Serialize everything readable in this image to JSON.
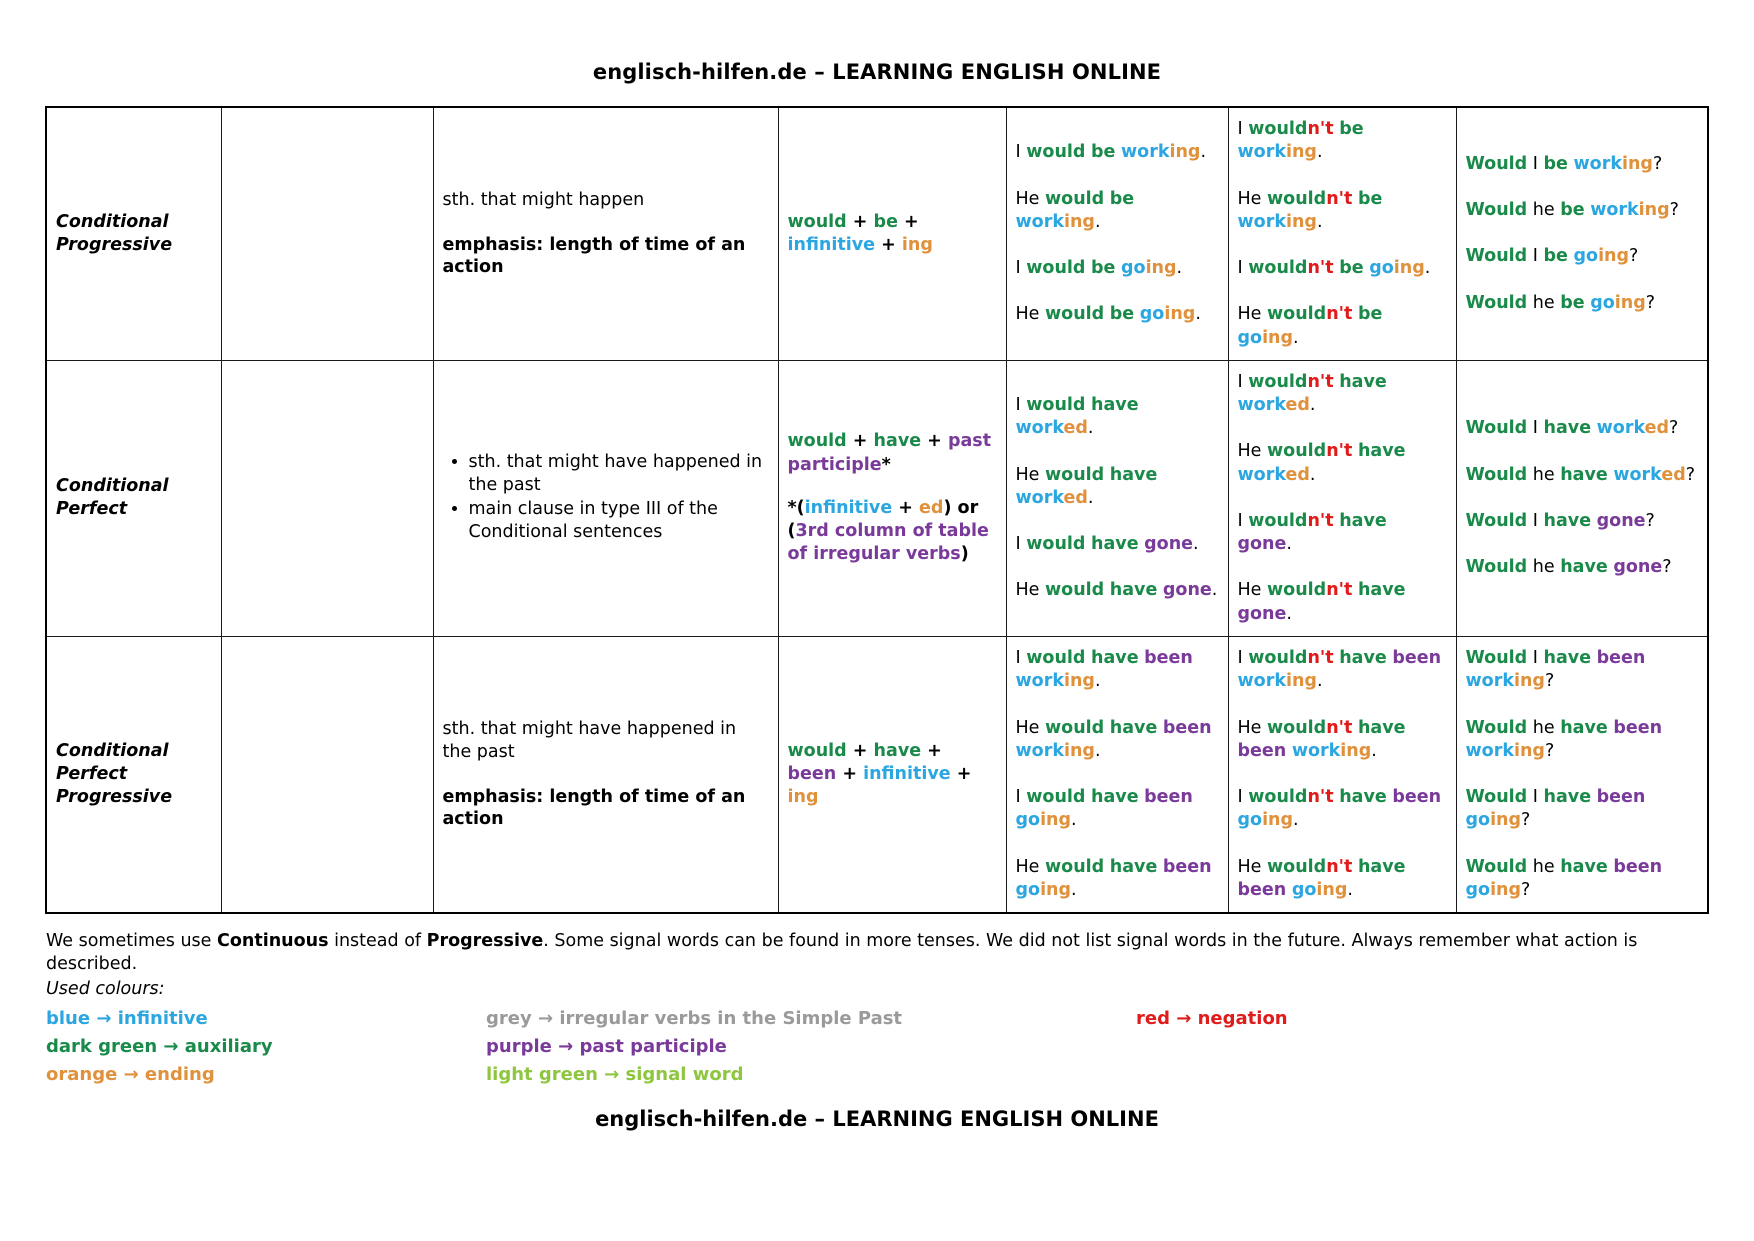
{
  "header": {
    "title": "englisch-hilfen.de – LEARNING ENGLISH ONLINE"
  },
  "footer": {
    "title": "englisch-hilfen.de – LEARNING ENGLISH ONLINE"
  },
  "colors": {
    "auxiliary": "#1a8a4a",
    "infinitive": "#2ba6e0",
    "ending": "#e0913c",
    "past_participle": "#7a3a99",
    "negation": "#e01b1b",
    "irregular": "#9a9a9a",
    "signal_word": "#8ec63f"
  },
  "rows": [
    {
      "tense": "Conditional Progressive",
      "signal_words": "",
      "use_plain": "sth. that might happen",
      "use_bold": "emphasis: length of time of an action",
      "use_list": [],
      "formula": "would + be + infinitive + ing",
      "formula_note": "",
      "affirmative": [
        "I would be working.",
        "He would be working.",
        "I would be going.",
        "He would be going."
      ],
      "negative": [
        "I wouldn't be working.",
        "He wouldn't be working.",
        "I wouldn't be going.",
        "He wouldn't be going."
      ],
      "question": [
        "Would I be working?",
        "Would he be working?",
        "Would I be going?",
        "Would he be going?"
      ]
    },
    {
      "tense": "Conditional Perfect",
      "signal_words": "",
      "use_plain": "",
      "use_bold": "",
      "use_list": [
        "sth. that might have happened in the past",
        "main clause in type III of the Conditional sentences"
      ],
      "formula": "would + have + past participle*",
      "formula_note": "*(infinitive + ed) or (3rd column of table of irregular verbs)",
      "affirmative": [
        "I would have worked.",
        "He would have worked.",
        "I would have gone.",
        "He would have gone."
      ],
      "negative": [
        "I wouldn't have worked.",
        "He wouldn't have worked.",
        "I wouldn't have gone.",
        "He wouldn't have gone."
      ],
      "question": [
        "Would I have worked?",
        "Would he have worked?",
        "Would I have gone?",
        "Would he have gone?"
      ]
    },
    {
      "tense": "Conditional Perfect Progressive",
      "signal_words": "",
      "use_plain": "sth. that might have happened in the past",
      "use_bold": "emphasis: length of time of an action",
      "use_list": [],
      "formula": "would + have + been + infinitive + ing",
      "formula_note": "",
      "affirmative": [
        "I would have been working.",
        "He would have been working.",
        "I would have been going.",
        "He would have been going."
      ],
      "negative": [
        "I wouldn't have been working.",
        "He wouldn't have been working.",
        "I wouldn't have been going.",
        "He wouldn't have been going."
      ],
      "question": [
        "Would I have been working?",
        "Would he have been working?",
        "Would I have been going?",
        "Would he have been going?"
      ]
    }
  ],
  "notes": {
    "paragraph_parts": [
      {
        "text": "We sometimes use ",
        "bold": false
      },
      {
        "text": "Continuous",
        "bold": true
      },
      {
        "text": " instead of ",
        "bold": false
      },
      {
        "text": "Progressive",
        "bold": true
      },
      {
        "text": ". Some signal words can be found in more tenses. We did not list signal words in the future. Always remember what action is described.",
        "bold": false
      }
    ],
    "used_colours_label": "Used colours:",
    "legend": [
      {
        "name": "blue",
        "arrow": "→",
        "meaning": "infinitive",
        "color_key": "infinitive"
      },
      {
        "name": "grey",
        "arrow": "→",
        "meaning": "irregular verbs in the Simple Past",
        "color_key": "irregular"
      },
      {
        "name": "red",
        "arrow": "→",
        "meaning": "negation",
        "color_key": "negation"
      },
      {
        "name": "dark green",
        "arrow": "→",
        "meaning": "auxiliary",
        "color_key": "auxiliary"
      },
      {
        "name": "purple",
        "arrow": "→",
        "meaning": "past participle",
        "color_key": "past_participle"
      },
      {
        "name": "",
        "arrow": "",
        "meaning": "",
        "color_key": ""
      },
      {
        "name": "orange",
        "arrow": "→",
        "meaning": "ending",
        "color_key": "ending"
      },
      {
        "name": "light green",
        "arrow": "→",
        "meaning": "signal word",
        "color_key": "signal_word"
      },
      {
        "name": "",
        "arrow": "",
        "meaning": "",
        "color_key": ""
      }
    ]
  }
}
